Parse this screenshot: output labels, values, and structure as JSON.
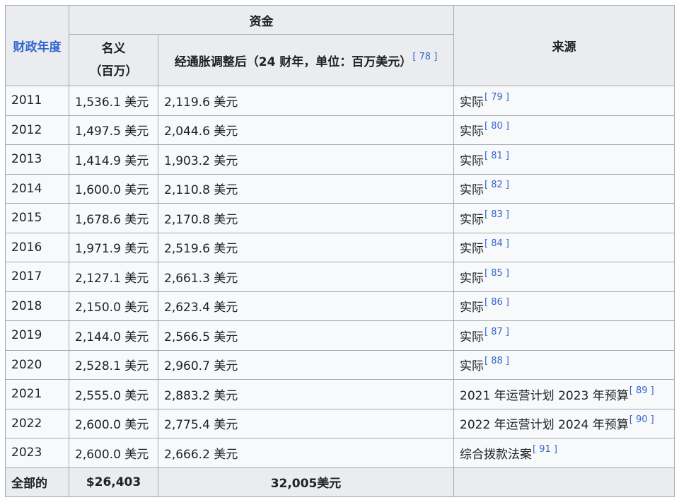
{
  "headers": {
    "fiscal_year": "财政年度",
    "funding": "资金",
    "nominal": "名义",
    "nominal_unit": "（百万）",
    "adjusted": "经通胀调整后（24 财年，单位：百万美元）",
    "adjusted_ref": "[ 78 ]",
    "source": "来源"
  },
  "rows": [
    {
      "year": "2011",
      "nominal": "1,536.1 美元",
      "adjusted": "2,119.6 美元",
      "source": "实际",
      "ref": "[ 79 ]"
    },
    {
      "year": "2012",
      "nominal": "1,497.5 美元",
      "adjusted": "2,044.6 美元",
      "source": "实际",
      "ref": "[ 80 ]"
    },
    {
      "year": "2013",
      "nominal": "1,414.9 美元",
      "adjusted": "1,903.2 美元",
      "source": "实际",
      "ref": "[ 81 ]"
    },
    {
      "year": "2014",
      "nominal": "1,600.0 美元",
      "adjusted": "2,110.8 美元",
      "source": "实际",
      "ref": "[ 82 ]"
    },
    {
      "year": "2015",
      "nominal": "1,678.6 美元",
      "adjusted": "2,170.8 美元",
      "source": "实际",
      "ref": "[ 83 ]"
    },
    {
      "year": "2016",
      "nominal": "1,971.9 美元",
      "adjusted": "2,519.6 美元",
      "source": "实际",
      "ref": "[ 84 ]"
    },
    {
      "year": "2017",
      "nominal": "2,127.1 美元",
      "adjusted": "2,661.3 美元",
      "source": "实际",
      "ref": "[ 85 ]"
    },
    {
      "year": "2018",
      "nominal": "2,150.0 美元",
      "adjusted": "2,623.4 美元",
      "source": "实际",
      "ref": "[ 86 ]"
    },
    {
      "year": "2019",
      "nominal": "2,144.0 美元",
      "adjusted": "2,566.5 美元",
      "source": "实际",
      "ref": "[ 87 ]"
    },
    {
      "year": "2020",
      "nominal": "2,528.1 美元",
      "adjusted": "2,960.7 美元",
      "source": "实际",
      "ref": "[ 88 ]"
    },
    {
      "year": "2021",
      "nominal": "2,555.0 美元",
      "adjusted": "2,883.2 美元",
      "source": "2021 年运营计划 2023 年预算",
      "ref": "[ 89 ]"
    },
    {
      "year": "2022",
      "nominal": "2,600.0 美元",
      "adjusted": "2,775.4 美元",
      "source": "2022 年运营计划 2024 年预算",
      "ref": "[ 90 ]"
    },
    {
      "year": "2023",
      "nominal": "2,600.0 美元",
      "adjusted": "2,666.2 美元",
      "source": "综合拨款法案",
      "ref": "[ 91 ]"
    }
  ],
  "total": {
    "label": "全部的",
    "nominal": "$26,403",
    "adjusted": "32,005美元"
  },
  "colors": {
    "link": "#3366cc",
    "header_bg": "#eaecf0",
    "cell_bg": "#f8f9fa",
    "border": "#a2a9b1"
  }
}
